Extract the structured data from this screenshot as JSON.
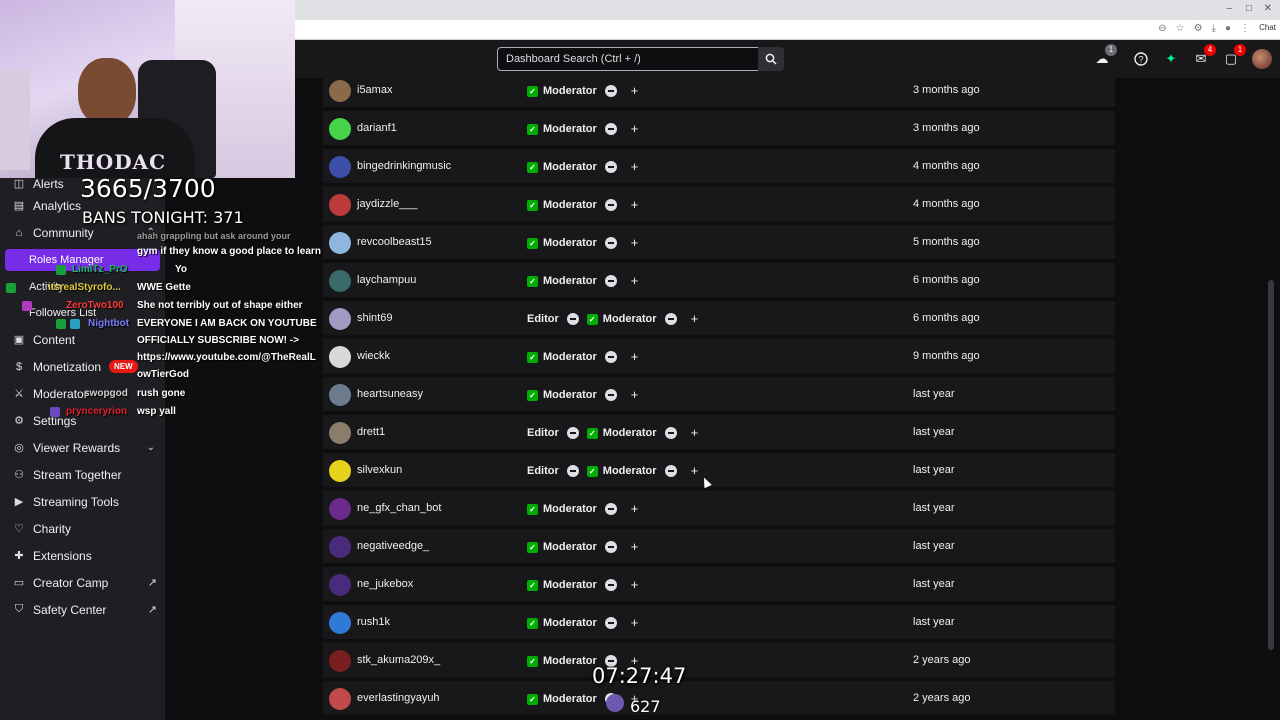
{
  "browser": {
    "chat_label": "Chat",
    "controls": [
      "–",
      "□",
      "✕"
    ]
  },
  "topnav": {
    "search_placeholder": "Dashboard Search (Ctrl + /)",
    "badges": {
      "drops": "1",
      "inbox": "4",
      "whispers": "1"
    }
  },
  "sidebar": {
    "items": [
      {
        "label": "Alerts",
        "icon": "alert-icon"
      },
      {
        "label": "Analytics",
        "icon": "analytics-icon"
      },
      {
        "label": "Community",
        "icon": "community-icon"
      },
      {
        "label": "Roles Manager",
        "icon": ""
      },
      {
        "label": "Activity",
        "icon": ""
      },
      {
        "label": "Followers List",
        "icon": ""
      },
      {
        "label": "Content",
        "icon": "content-icon"
      },
      {
        "label": "Monetization",
        "icon": "monetization-icon",
        "badge": "NEW"
      },
      {
        "label": "Moderator",
        "icon": "moderator-icon"
      },
      {
        "label": "Settings",
        "icon": "gear-icon"
      },
      {
        "label": "Viewer Rewards",
        "icon": "rewards-icon"
      },
      {
        "label": "Stream Together",
        "icon": "stream-together-icon"
      },
      {
        "label": "Streaming Tools",
        "icon": "streaming-tools-icon"
      },
      {
        "label": "Charity",
        "icon": "charity-icon"
      },
      {
        "label": "Extensions",
        "icon": "extensions-icon"
      },
      {
        "label": "Creator Camp",
        "icon": "creator-camp-icon"
      },
      {
        "label": "Safety Center",
        "icon": "safety-icon"
      }
    ]
  },
  "overlay": {
    "ban_count": "3665/3700",
    "bans_tonight": "BANS TONIGHT: 371",
    "timer": "07:27:47",
    "viewers": "627",
    "cam_shirt": "THODAC",
    "chat": [
      {
        "user": "",
        "msg": "gym if they know a good place to learn",
        "color": "#ffffff"
      },
      {
        "user": "LimiTz_PrO",
        "msg": "Yo",
        "color": "#1db954"
      },
      {
        "user": "itsrealStyrofo...",
        "msg": "WWE Gette",
        "color": "#e0c73a"
      },
      {
        "user": "ZeroTwo100",
        "msg": "She not terribly out of shape either",
        "color": "#ff3b3b"
      },
      {
        "user": "Nightbot",
        "msg": "EVERYONE I AM BACK ON YOUTUBE",
        "color": "#7b7bff"
      },
      {
        "user": "",
        "msg": "OFFICIALLY SUBSCRIBE NOW! ->",
        "color": "#ffffff"
      },
      {
        "user": "",
        "msg": "https://www.youtube.com/@TheRealL",
        "color": "#ffffff"
      },
      {
        "user": "",
        "msg": "owTierGod",
        "color": "#ffffff"
      },
      {
        "user": "swopgod",
        "msg": "rush gone",
        "color": "#cfcfcf"
      },
      {
        "user": "prynceryrion",
        "msg": "wsp yall",
        "color": "#e2202b"
      }
    ],
    "partial_chat_top": "ahah grappling but ask around your"
  },
  "roles": {
    "moderator_label": "Moderator",
    "editor_label": "Editor",
    "rows": [
      {
        "name": "i5amax",
        "roles": [
          "Moderator"
        ],
        "added": "3 months ago",
        "avatar": "#8a6a4a"
      },
      {
        "name": "darianf1",
        "roles": [
          "Moderator"
        ],
        "added": "3 months ago",
        "avatar": "#45d34a"
      },
      {
        "name": "bingedrinkingmusic",
        "roles": [
          "Moderator"
        ],
        "added": "4 months ago",
        "avatar": "#3d4ea8"
      },
      {
        "name": "jaydizzle___",
        "roles": [
          "Moderator"
        ],
        "added": "4 months ago",
        "avatar": "#bb3a3a"
      },
      {
        "name": "revcoolbeast15",
        "roles": [
          "Moderator"
        ],
        "added": "5 months ago",
        "avatar": "#8fb7dd"
      },
      {
        "name": "laychampuu",
        "roles": [
          "Moderator"
        ],
        "added": "6 months ago",
        "avatar": "#3a6a6a"
      },
      {
        "name": "shint69",
        "roles": [
          "Editor",
          "Moderator"
        ],
        "added": "6 months ago",
        "avatar": "#a29ac2"
      },
      {
        "name": "wieckk",
        "roles": [
          "Moderator"
        ],
        "added": "9 months ago",
        "avatar": "#d8d8d8"
      },
      {
        "name": "heartsuneasy",
        "roles": [
          "Moderator"
        ],
        "added": "last year",
        "avatar": "#6d7b8f"
      },
      {
        "name": "drett1",
        "roles": [
          "Editor",
          "Moderator"
        ],
        "added": "last year",
        "avatar": "#8b7d6b"
      },
      {
        "name": "silvexkun",
        "roles": [
          "Editor",
          "Moderator"
        ],
        "added": "last year",
        "avatar": "#e6d21c"
      },
      {
        "name": "ne_gfx_chan_bot",
        "roles": [
          "Moderator"
        ],
        "added": "last year",
        "avatar": "#6a2b8a"
      },
      {
        "name": "negativeedge_",
        "roles": [
          "Moderator"
        ],
        "added": "last year",
        "avatar": "#4a2a7a"
      },
      {
        "name": "ne_jukebox",
        "roles": [
          "Moderator"
        ],
        "added": "last year",
        "avatar": "#4a2a7a"
      },
      {
        "name": "rush1k",
        "roles": [
          "Moderator"
        ],
        "added": "last year",
        "avatar": "#2f7ad6"
      },
      {
        "name": "stk_akuma209x_",
        "roles": [
          "Moderator"
        ],
        "added": "2 years ago",
        "avatar": "#7a1f1f"
      },
      {
        "name": "everlastingyayuh",
        "roles": [
          "Moderator"
        ],
        "added": "2 years ago",
        "avatar": "#c04a4a"
      }
    ]
  }
}
